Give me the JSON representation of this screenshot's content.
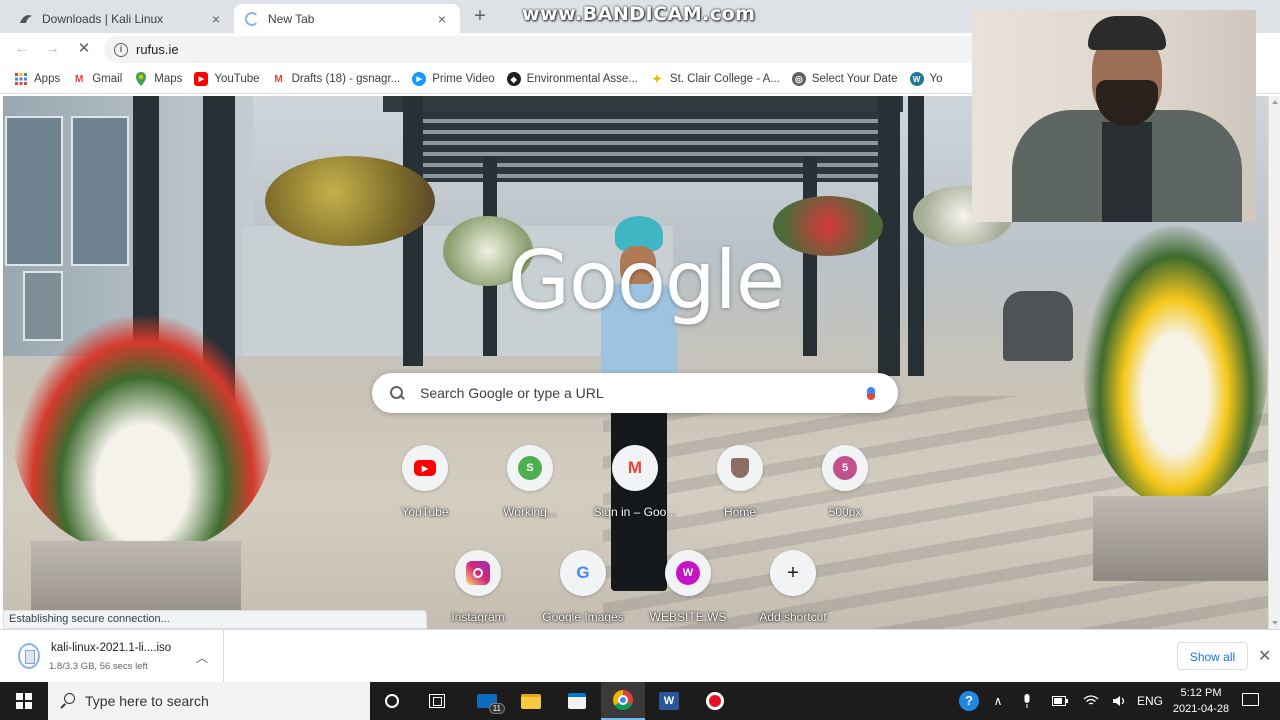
{
  "browser": {
    "tabs": [
      {
        "title": "Downloads | Kali Linux",
        "active": false,
        "icon": "kali-dragon-icon"
      },
      {
        "title": "New Tab",
        "active": true,
        "icon": "loading-spinner-icon"
      }
    ],
    "new_tab_symbol": "+",
    "close_symbol": "×",
    "watermark": "www.BANDICAM.com",
    "nav": {
      "back": "←",
      "forward": "→",
      "stop": "✕"
    },
    "address": {
      "url": "rufus.ie",
      "info_symbol": "i"
    },
    "bookmarks": [
      {
        "label": "Apps",
        "icon": "apps-grid-icon"
      },
      {
        "label": "Gmail",
        "icon": "gmail-icon"
      },
      {
        "label": "Maps",
        "icon": "maps-icon"
      },
      {
        "label": "YouTube",
        "icon": "youtube-icon"
      },
      {
        "label": "Drafts (18) - gsnagr...",
        "icon": "gmail-icon"
      },
      {
        "label": "Prime Video",
        "icon": "prime-video-icon"
      },
      {
        "label": "Environmental Asse...",
        "icon": "shield-icon"
      },
      {
        "label": "St. Clair College - A...",
        "icon": "college-icon"
      },
      {
        "label": "Select Your Date",
        "icon": "globe-icon"
      },
      {
        "label": "Yo",
        "icon": "wordpress-icon"
      }
    ]
  },
  "newtab": {
    "logo": "Google",
    "search_placeholder": "Search Google or type a URL",
    "shortcuts_row1": [
      {
        "label": "YouTube",
        "letter": "",
        "color": "#ff0000"
      },
      {
        "label": "Working...",
        "letter": "S",
        "color": "#4caf50"
      },
      {
        "label": "Sign in – Goo...",
        "letter": "M",
        "color": "#ea4335"
      },
      {
        "label": "Home",
        "letter": "",
        "color": "#8d6e63"
      },
      {
        "label": "500px",
        "letter": "5",
        "color": "#c2528b"
      }
    ],
    "shortcuts_row2": [
      {
        "label": "Instagram",
        "letter": "",
        "color": "#d6249f"
      },
      {
        "label": "Google Images",
        "letter": "G",
        "color": "#4285f4"
      },
      {
        "label": "WEBSITE.WS",
        "letter": "W",
        "color": "#c514c5"
      },
      {
        "label": "Add shortcut",
        "letter": "+",
        "color": "#202124"
      }
    ],
    "status_text": "Establishing secure connection...",
    "customize_icon": "pencil-icon"
  },
  "downloads": {
    "filename": "kali-linux-2021.1-li....iso",
    "status": "1.8/3.3 GB, 56 secs left",
    "show_all": "Show all"
  },
  "taskbar": {
    "search_placeholder": "Type here to search",
    "mail_badge": "11",
    "word_letter": "W",
    "help_symbol": "?",
    "language": "ENG",
    "time": "5:12 PM",
    "date": "2021-04-28"
  },
  "colors": {
    "chrome_tabstrip": "#dee1e6",
    "link_blue": "#1a73e8",
    "taskbar": "#1c1c1c"
  }
}
